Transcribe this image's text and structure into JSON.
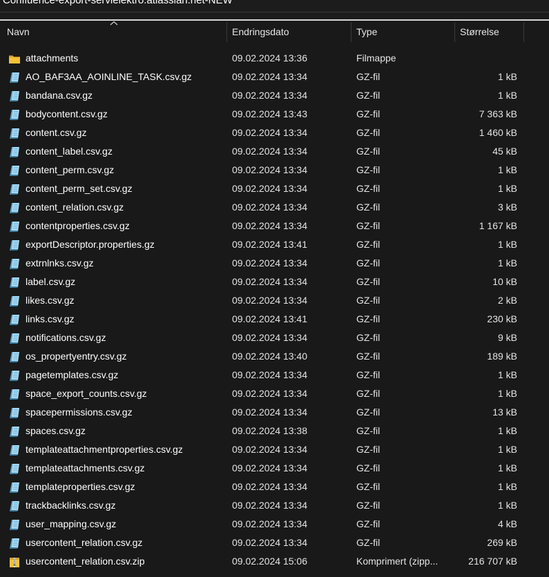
{
  "window": {
    "title": "Confluence-export-servielektro.atlassian.net-NEW"
  },
  "columns": {
    "name": "Navn",
    "date": "Endringsdato",
    "type": "Type",
    "size": "Størrelse"
  },
  "files": [
    {
      "name": "attachments",
      "date": "09.02.2024 13:36",
      "type": "Filmappe",
      "size": "",
      "icon": "folder-icon"
    },
    {
      "name": "AO_BAF3AA_AOINLINE_TASK.csv.gz",
      "date": "09.02.2024 13:34",
      "type": "GZ-fil",
      "size": "1 kB",
      "icon": "gz-file-icon"
    },
    {
      "name": "bandana.csv.gz",
      "date": "09.02.2024 13:34",
      "type": "GZ-fil",
      "size": "1 kB",
      "icon": "gz-file-icon"
    },
    {
      "name": "bodycontent.csv.gz",
      "date": "09.02.2024 13:43",
      "type": "GZ-fil",
      "size": "7 363 kB",
      "icon": "gz-file-icon"
    },
    {
      "name": "content.csv.gz",
      "date": "09.02.2024 13:34",
      "type": "GZ-fil",
      "size": "1 460 kB",
      "icon": "gz-file-icon"
    },
    {
      "name": "content_label.csv.gz",
      "date": "09.02.2024 13:34",
      "type": "GZ-fil",
      "size": "45 kB",
      "icon": "gz-file-icon"
    },
    {
      "name": "content_perm.csv.gz",
      "date": "09.02.2024 13:34",
      "type": "GZ-fil",
      "size": "1 kB",
      "icon": "gz-file-icon"
    },
    {
      "name": "content_perm_set.csv.gz",
      "date": "09.02.2024 13:34",
      "type": "GZ-fil",
      "size": "1 kB",
      "icon": "gz-file-icon"
    },
    {
      "name": "content_relation.csv.gz",
      "date": "09.02.2024 13:34",
      "type": "GZ-fil",
      "size": "3 kB",
      "icon": "gz-file-icon"
    },
    {
      "name": "contentproperties.csv.gz",
      "date": "09.02.2024 13:34",
      "type": "GZ-fil",
      "size": "1 167 kB",
      "icon": "gz-file-icon"
    },
    {
      "name": "exportDescriptor.properties.gz",
      "date": "09.02.2024 13:41",
      "type": "GZ-fil",
      "size": "1 kB",
      "icon": "gz-file-icon"
    },
    {
      "name": "extrnlnks.csv.gz",
      "date": "09.02.2024 13:34",
      "type": "GZ-fil",
      "size": "1 kB",
      "icon": "gz-file-icon"
    },
    {
      "name": "label.csv.gz",
      "date": "09.02.2024 13:34",
      "type": "GZ-fil",
      "size": "10 kB",
      "icon": "gz-file-icon"
    },
    {
      "name": "likes.csv.gz",
      "date": "09.02.2024 13:34",
      "type": "GZ-fil",
      "size": "2 kB",
      "icon": "gz-file-icon"
    },
    {
      "name": "links.csv.gz",
      "date": "09.02.2024 13:41",
      "type": "GZ-fil",
      "size": "230 kB",
      "icon": "gz-file-icon"
    },
    {
      "name": "notifications.csv.gz",
      "date": "09.02.2024 13:34",
      "type": "GZ-fil",
      "size": "9 kB",
      "icon": "gz-file-icon"
    },
    {
      "name": "os_propertyentry.csv.gz",
      "date": "09.02.2024 13:40",
      "type": "GZ-fil",
      "size": "189 kB",
      "icon": "gz-file-icon"
    },
    {
      "name": "pagetemplates.csv.gz",
      "date": "09.02.2024 13:34",
      "type": "GZ-fil",
      "size": "1 kB",
      "icon": "gz-file-icon"
    },
    {
      "name": "space_export_counts.csv.gz",
      "date": "09.02.2024 13:34",
      "type": "GZ-fil",
      "size": "1 kB",
      "icon": "gz-file-icon"
    },
    {
      "name": "spacepermissions.csv.gz",
      "date": "09.02.2024 13:34",
      "type": "GZ-fil",
      "size": "13 kB",
      "icon": "gz-file-icon"
    },
    {
      "name": "spaces.csv.gz",
      "date": "09.02.2024 13:38",
      "type": "GZ-fil",
      "size": "1 kB",
      "icon": "gz-file-icon"
    },
    {
      "name": "templateattachmentproperties.csv.gz",
      "date": "09.02.2024 13:34",
      "type": "GZ-fil",
      "size": "1 kB",
      "icon": "gz-file-icon"
    },
    {
      "name": "templateattachments.csv.gz",
      "date": "09.02.2024 13:34",
      "type": "GZ-fil",
      "size": "1 kB",
      "icon": "gz-file-icon"
    },
    {
      "name": "templateproperties.csv.gz",
      "date": "09.02.2024 13:34",
      "type": "GZ-fil",
      "size": "1 kB",
      "icon": "gz-file-icon"
    },
    {
      "name": "trackbacklinks.csv.gz",
      "date": "09.02.2024 13:34",
      "type": "GZ-fil",
      "size": "1 kB",
      "icon": "gz-file-icon"
    },
    {
      "name": "user_mapping.csv.gz",
      "date": "09.02.2024 13:34",
      "type": "GZ-fil",
      "size": "4 kB",
      "icon": "gz-file-icon"
    },
    {
      "name": "usercontent_relation.csv.gz",
      "date": "09.02.2024 13:34",
      "type": "GZ-fil",
      "size": "269 kB",
      "icon": "gz-file-icon"
    },
    {
      "name": "usercontent_relation.csv.zip",
      "date": "09.02.2024 15:06",
      "type": "Komprimert (zipp...",
      "size": "216 707 kB",
      "icon": "zip-file-icon"
    }
  ],
  "colors": {
    "background": "#191919",
    "text": "#ffffff",
    "folder": "#f3c13a",
    "gz_icon": "#8ec9e8"
  }
}
